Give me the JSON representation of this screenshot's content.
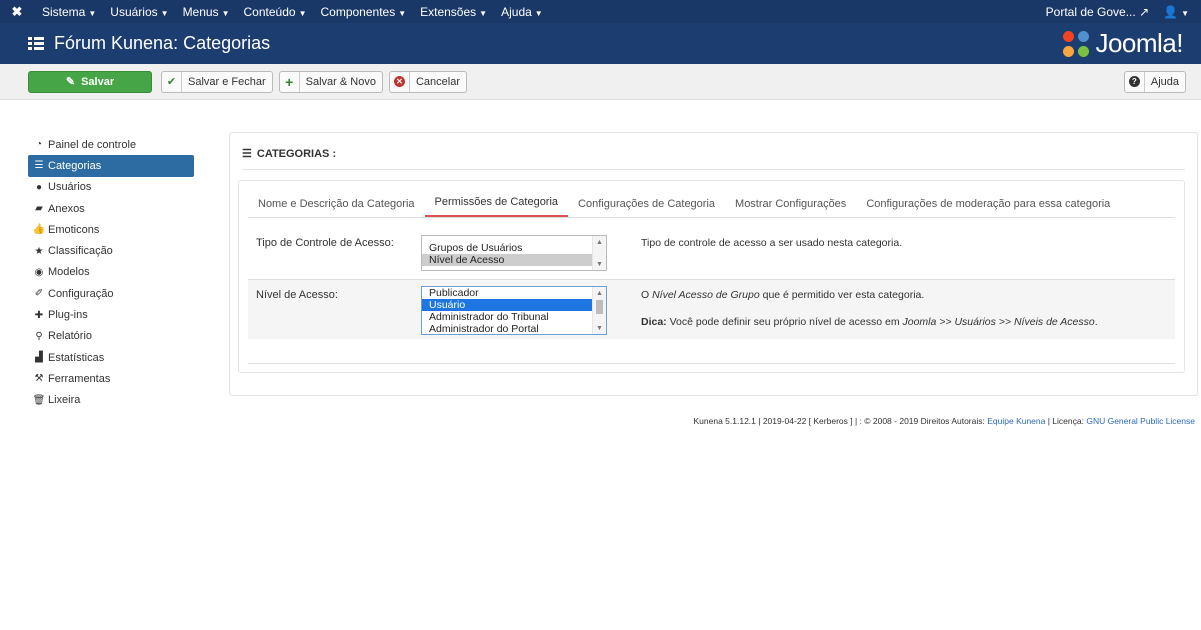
{
  "topbar": {
    "menu": [
      "Sistema",
      "Usuários",
      "Menus",
      "Conteúdo",
      "Componentes",
      "Extensões",
      "Ajuda"
    ],
    "site_name": "Portal de Gove...",
    "icons": {
      "brand": "joomla-icon",
      "external": "external-link-icon",
      "user": "user-icon"
    }
  },
  "header": {
    "title": "Fórum Kunena: Categorias",
    "logo_text": "Joomla!"
  },
  "toolbar": {
    "save": "Salvar",
    "save_close": "Salvar e Fechar",
    "save_new": "Salvar & Novo",
    "cancel": "Cancelar",
    "help": "Ajuda"
  },
  "sidebar": {
    "items": [
      {
        "label": "Painel de controle",
        "icon": "dashboard-icon"
      },
      {
        "label": "Categorias",
        "icon": "list-icon",
        "active": true
      },
      {
        "label": "Usuários",
        "icon": "user-icon"
      },
      {
        "label": "Anexos",
        "icon": "folder-icon"
      },
      {
        "label": "Emoticons",
        "icon": "thumbs-up-icon"
      },
      {
        "label": "Classificação",
        "icon": "star-icon"
      },
      {
        "label": "Modelos",
        "icon": "eye-icon"
      },
      {
        "label": "Configuração",
        "icon": "wrench-icon"
      },
      {
        "label": "Plug-ins",
        "icon": "puzzle-icon"
      },
      {
        "label": "Relatório",
        "icon": "search-icon"
      },
      {
        "label": "Estatísticas",
        "icon": "chart-icon"
      },
      {
        "label": "Ferramentas",
        "icon": "tools-icon"
      },
      {
        "label": "Lixeira",
        "icon": "trash-icon"
      }
    ]
  },
  "main": {
    "section_title": "CATEGORIAS :",
    "tabs": [
      {
        "label": "Nome e Descrição da Categoria"
      },
      {
        "label": "Permissões de Categoria",
        "active": true
      },
      {
        "label": "Configurações de Categoria"
      },
      {
        "label": "Mostrar Configurações"
      },
      {
        "label": "Configurações de moderação para essa categoria"
      }
    ],
    "access_type": {
      "label": "Tipo de Controle de Acesso:",
      "options": [
        "Grupos de Usuários",
        "Nível de Acesso"
      ],
      "selected": "Nível de Acesso",
      "description": "Tipo de controle de acesso a ser usado nesta categoria."
    },
    "access_level": {
      "label": "Nível de Acesso:",
      "options": [
        "Publicador",
        "Usuário",
        "Administrador do Tribunal",
        "Administrador do Portal"
      ],
      "selected": "Usuário",
      "desc_prefix": "O ",
      "desc_em": "Nível Acesso de Grupo",
      "desc_suffix": " que é permitido ver esta categoria.",
      "tip_label": "Dica:",
      "tip_text": " Você pode definir seu próprio nível de acesso em ",
      "tip_path": "Joomla >> Usuários >> Níveis de Acesso",
      "tip_end": "."
    }
  },
  "footer": {
    "text": "Kunena 5.1.12.1 | 2019-04-22 [ Kerberos ] | : © 2008 - 2019 Direitos Autorais: ",
    "team_link": "Equipe Kunena",
    "license_label": " | Licença: ",
    "license_link": "GNU General Public License"
  },
  "colors": {
    "topbar": "#1a3867",
    "header": "#1c3d6f",
    "save": "#46a546",
    "active": "#2d6ca2",
    "tab_active": "#d9534f"
  }
}
